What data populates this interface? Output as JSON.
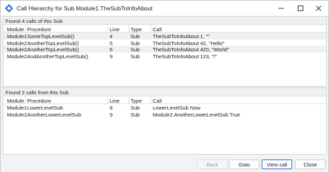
{
  "window": {
    "title": "Call Hierarchy for Sub Module1.TheSubToInfoAbout",
    "accent_color": "#2b6cd3"
  },
  "callers": {
    "header": "Found 4 calls of this Sub",
    "columns": [
      "Module",
      "Procedure",
      "Line",
      "Type",
      "Call"
    ],
    "rows": [
      [
        "Module1",
        "SomeTopLevelSub()",
        "4",
        "Sub",
        "TheSubToInfoAbout 1, \"\""
      ],
      [
        "Module2",
        "AnotherTopLevelSub()",
        "5",
        "Sub",
        "TheSubToInfoAbout 42, \"Hello\""
      ],
      [
        "Module2",
        "AnotherTopLevelSub()",
        "6",
        "Sub",
        "TheSubToInfoAbout 420, \"World\""
      ],
      [
        "Module2",
        "AndAnotherTopLevelSub()",
        "9",
        "Sub",
        "TheSubToInfoAbout 123, \"!\""
      ]
    ]
  },
  "callees": {
    "header": "Found 2 calls from this Sub",
    "columns": [
      "Module",
      "Procedure",
      "Line",
      "Type",
      "Call"
    ],
    "rows": [
      [
        "Module1",
        "LowerLevelSub",
        "8",
        "Sub",
        "LowerLevelSub Now"
      ],
      [
        "Module2",
        "AnotherLowerLevelSub",
        "9",
        "Sub",
        "Module2.AnotherLowerLevelSub True"
      ]
    ]
  },
  "buttons": {
    "back": "Back",
    "goto": "Goto",
    "view_call": "View call",
    "close": "Close"
  },
  "icons": {
    "app": "vba-diamond-icon",
    "minimize": "minimize-icon",
    "maximize": "maximize-icon",
    "close": "close-icon"
  }
}
